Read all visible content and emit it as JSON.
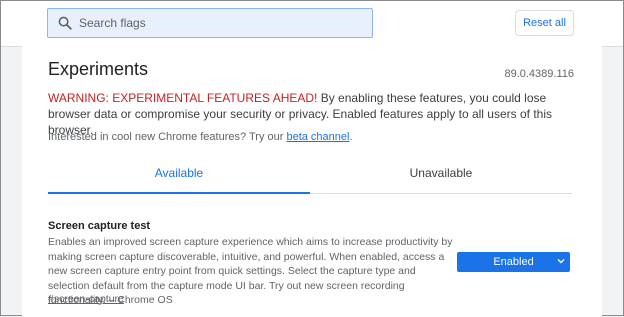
{
  "header": {
    "search_placeholder": "Search flags",
    "reset_label": "Reset all"
  },
  "page": {
    "title": "Experiments",
    "version": "89.0.4389.116",
    "warning_prefix": "WARNING: EXPERIMENTAL FEATURES AHEAD!",
    "warning_text": " By enabling these features, you could lose browser data or compromise your security or privacy. Enabled features apply to all users of this browser.",
    "beta_text": "Interested in cool new Chrome features? Try our ",
    "beta_link": "beta channel",
    "beta_suffix": "."
  },
  "tabs": [
    {
      "label": "Available",
      "active": true
    },
    {
      "label": "Unavailable",
      "active": false
    }
  ],
  "experiment": {
    "name": "Screen capture test",
    "description": "Enables an improved screen capture experience which aims to increase productivity by making screen capture discoverable, intuitive, and powerful. When enabled, access a new screen capture entry point from quick settings. Select the capture type and selection default from the capture mode UI bar. Try out new screen recording functionality. – Chrome OS",
    "tag": "#screen-capture",
    "state": "Enabled"
  },
  "colors": {
    "accent": "#1a73e8",
    "warning": "#c5221f"
  },
  "icons": {
    "search": "search-icon",
    "dropdown": "chevron-down-icon"
  }
}
